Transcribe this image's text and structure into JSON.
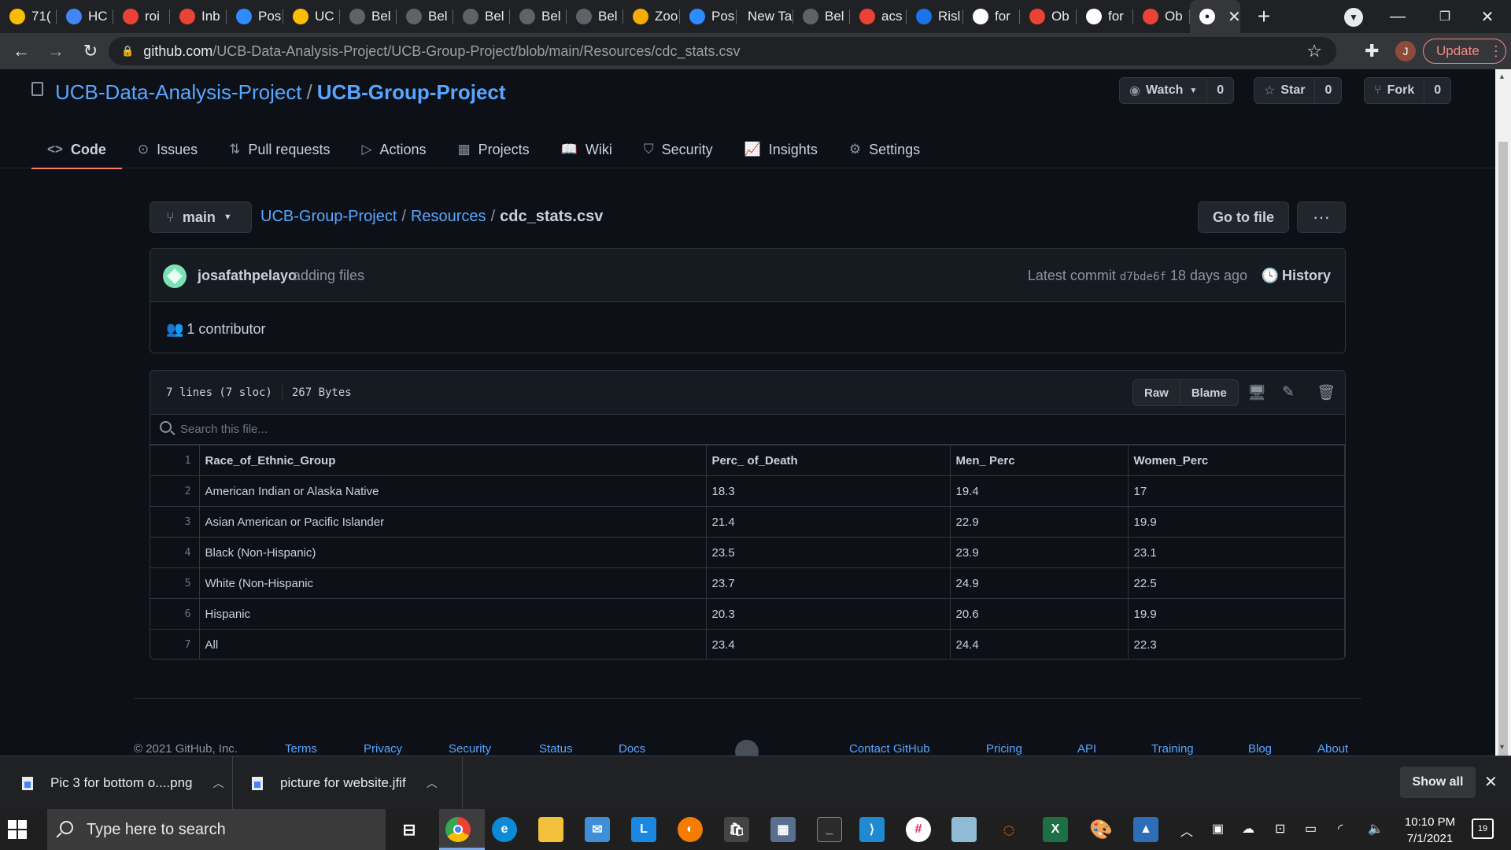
{
  "browser": {
    "tabs": [
      {
        "label": "71(",
        "icon": "google-drive-icon",
        "color": "#fbbc04"
      },
      {
        "label": "HC",
        "icon": "grid-icon",
        "color": "#4285f4"
      },
      {
        "label": "roi",
        "icon": "google-icon",
        "color": "#ea4335"
      },
      {
        "label": "Inb",
        "icon": "gmail-icon",
        "color": "#ea4335"
      },
      {
        "label": "Pos",
        "icon": "zoom-icon",
        "color": "#2d8cff"
      },
      {
        "label": "UC",
        "icon": "slides-icon",
        "color": "#fbbc04"
      },
      {
        "label": "Bel",
        "icon": "globe-icon",
        "color": "#5f6368"
      },
      {
        "label": "Bel",
        "icon": "globe-icon",
        "color": "#5f6368"
      },
      {
        "label": "Bel",
        "icon": "globe-icon",
        "color": "#5f6368"
      },
      {
        "label": "Bel",
        "icon": "globe-icon",
        "color": "#5f6368"
      },
      {
        "label": "Bel",
        "icon": "globe-icon",
        "color": "#5f6368"
      },
      {
        "label": "Zoo",
        "icon": "zoom-meeting-icon",
        "color": "#f9ab00"
      },
      {
        "label": "Pos",
        "icon": "zoom-icon",
        "color": "#2d8cff"
      },
      {
        "label": "New Tal",
        "icon": "",
        "color": ""
      },
      {
        "label": "Bel",
        "icon": "globe-icon",
        "color": "#5f6368"
      },
      {
        "label": "acs",
        "icon": "google-icon",
        "color": "#ea4335"
      },
      {
        "label": "Risl",
        "icon": "s-logo-icon",
        "color": "#1a73e8"
      },
      {
        "label": "for",
        "icon": "bird-icon",
        "color": "#ffffff"
      },
      {
        "label": "Ob",
        "icon": "figure-icon",
        "color": "#ea4335"
      },
      {
        "label": "for",
        "icon": "bird-icon",
        "color": "#ffffff"
      },
      {
        "label": "Ob",
        "icon": "figure-icon",
        "color": "#ea4335"
      }
    ],
    "active_tab_icon": "github-icon",
    "url_host": "github.com",
    "url_path": "/UCB-Data-Analysis-Project/UCB-Group-Project/blob/main/Resources/cdc_stats.csv",
    "profile_initial": "J",
    "update_label": "Update"
  },
  "repo": {
    "owner": "UCB-Data-Analysis-Project",
    "name": "UCB-Group-Project",
    "watch_label": "Watch",
    "watch_count": "0",
    "star_label": "Star",
    "star_count": "0",
    "fork_label": "Fork",
    "fork_count": "0",
    "nav": [
      "Code",
      "Issues",
      "Pull requests",
      "Actions",
      "Projects",
      "Wiki",
      "Security",
      "Insights",
      "Settings"
    ]
  },
  "file": {
    "branch": "main",
    "crumb_repo": "UCB-Group-Project",
    "crumb_folder": "Resources",
    "crumb_file": "cdc_stats.csv",
    "go_to_file": "Go to file",
    "more": "···",
    "commit_author": "josafathpelayo",
    "commit_message": "adding files",
    "latest_commit_label": "Latest commit",
    "commit_sha": "d7bde6f",
    "commit_age": "18 days ago",
    "history_label": "History",
    "contributors": "1 contributor",
    "lines_info": "7 lines (7 sloc)",
    "size_info": "267 Bytes",
    "raw_label": "Raw",
    "blame_label": "Blame",
    "search_placeholder": "Search this file...",
    "csv_header": [
      "Race_of_Ethnic_Group",
      "Perc_ of_Death",
      "Men_ Perc",
      "Women_Perc"
    ],
    "csv_rows": [
      [
        "American Indian or Alaska Native",
        "18.3",
        "19.4",
        "17"
      ],
      [
        "Asian American or Pacific Islander",
        "21.4",
        "22.9",
        "19.9"
      ],
      [
        "Black (Non-Hispanic)",
        "23.5",
        "23.9",
        "23.1"
      ],
      [
        "White (Non-Hispanic",
        "23.7",
        "24.9",
        "22.5"
      ],
      [
        "Hispanic",
        "20.3",
        "20.6",
        "19.9"
      ],
      [
        "All",
        "23.4",
        "24.4",
        "22.3"
      ]
    ]
  },
  "footer": {
    "copyright": "© 2021 GitHub, Inc.",
    "links_left": [
      "Terms",
      "Privacy",
      "Security",
      "Status",
      "Docs"
    ],
    "links_right": [
      "Contact GitHub",
      "Pricing",
      "API",
      "Training",
      "Blog",
      "About"
    ]
  },
  "downloads": {
    "items": [
      "Pic 3 for bottom o....png",
      "picture for website.jfif"
    ],
    "show_all": "Show all"
  },
  "taskbar": {
    "search_placeholder": "Type here to search",
    "time": "10:10 PM",
    "date": "7/1/2021",
    "notification_count": "19",
    "apps": [
      "task-view-icon",
      "chrome-icon",
      "edge-icon",
      "file-explorer-icon",
      "mail-icon",
      "l-app-icon",
      "blender-icon",
      "store-icon",
      "calculator-icon",
      "terminal-icon",
      "vscode-icon",
      "slack-icon",
      "notepad-icon",
      "jupyter-icon",
      "excel-icon",
      "paint-icon",
      "photos-icon"
    ]
  }
}
